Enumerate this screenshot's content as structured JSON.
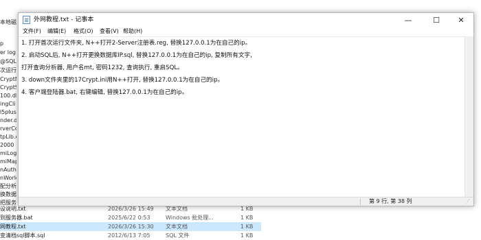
{
  "explorer": {
    "left_items": [
      "本地磁盘",
      "p",
      "er log",
      "@SQLZ",
      "次运行",
      "CryptN",
      "CryptS",
      "100.dll",
      "ingCli",
      "l5plus.",
      "nder.d",
      "rverCo",
      "tpLib.c",
      "2000",
      "miLogi",
      "miMap",
      "nAuthS",
      "nWorld",
      "配分析器",
      "换数据库",
      "把服务器"
    ],
    "rows": [
      {
        "name": "设说明.txt",
        "date": "2026/3/26 15:49",
        "type": "文本文档",
        "size": "1 KB",
        "selected": false
      },
      {
        "name": "到服务器.bat",
        "date": "2025/6/22 0:53",
        "type": "Windows 批处理...",
        "size": "1 KB",
        "selected": false
      },
      {
        "name": "网教程.txt",
        "date": "2026/3/26 15:30",
        "type": "文本文档",
        "size": "1 KB",
        "selected": true
      },
      {
        "name": "变清档sql脚本.sql",
        "date": "2012/6/13 7:05",
        "type": "SQL 文件",
        "size": "1 KB",
        "selected": false
      }
    ]
  },
  "notepad": {
    "title": "外网教程.txt - 记事本",
    "controls": {
      "minimize": "—",
      "maximize": "☐",
      "close": "✕"
    },
    "menu": {
      "file": "文件(F)",
      "edit": "编辑(E)",
      "format": "格式(O)",
      "view": "查看(V)",
      "help": "帮助(H)"
    },
    "lines": [
      "1. 打开首次运行文件夹, N++打开2-Server注册表.reg, 替换127.0.0.1为在自己的ip。",
      "2. 启动SQL后, N++打开更换数据库IP.sql, 替换127.0.0.1为在自己的ip, 复制所有文字,",
      "   打开查询分析器, 用户名mt, 密码1232, 查询执行, 重启SQL。",
      "3. down文件夹里的17Crypt.ini用N++打开, 替换127.0.0.1为在自己的ip。",
      "4. 客户端登陆器.bat, 右键编辑, 替换127.0.0.1为在自己的ip。"
    ],
    "status": {
      "position": "第 9 行, 第 38 列"
    }
  }
}
